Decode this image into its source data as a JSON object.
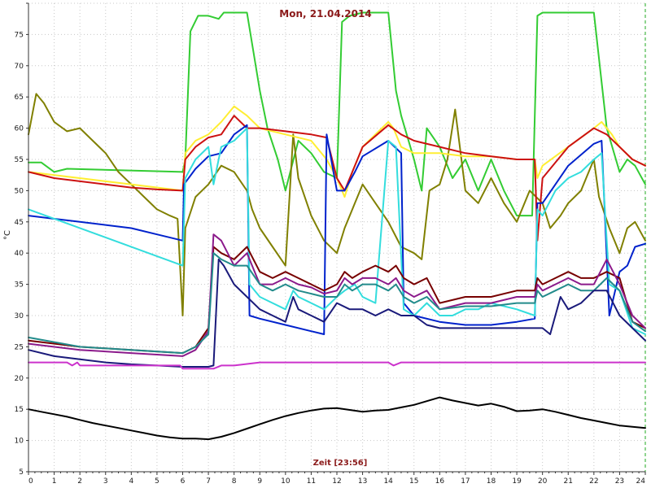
{
  "chart_data": {
    "type": "line",
    "title": "Mon, 21.04.2014",
    "xlabel": "Zeit [23:56]",
    "ylabel": "°C",
    "xlim": [
      0,
      24
    ],
    "ylim": [
      5,
      80
    ],
    "xticks": [
      0,
      1,
      2,
      3,
      4,
      5,
      6,
      7,
      8,
      9,
      10,
      11,
      12,
      13,
      14,
      15,
      16,
      17,
      18,
      19,
      20,
      21,
      22,
      23,
      24
    ],
    "yticks": [
      5,
      10,
      15,
      20,
      25,
      30,
      35,
      40,
      45,
      50,
      55,
      60,
      65,
      70,
      75,
      80
    ],
    "grid": true,
    "series": [
      {
        "color": "#33cc33",
        "x": [
          0,
          0.5,
          1,
          1.5,
          6,
          6.1,
          6.3,
          6.6,
          7,
          7.4,
          7.6,
          8,
          8.5,
          9,
          9.3,
          9.7,
          10,
          10.5,
          11,
          11.5,
          12,
          12.2,
          12.5,
          13,
          14,
          14.3,
          14.5,
          15,
          15.3,
          15.5,
          16,
          16.5,
          17,
          17.5,
          18,
          18.5,
          19,
          19.6,
          19.8,
          20,
          20.4,
          21,
          21.5,
          22,
          22.5,
          23,
          23.3,
          23.6,
          24
        ],
        "y": [
          54.5,
          54.5,
          53,
          53.5,
          53,
          55,
          75.5,
          78,
          78,
          77.5,
          78.5,
          78.5,
          78.5,
          66,
          60,
          55,
          50,
          58,
          56,
          53,
          52,
          77,
          78,
          78.5,
          78.5,
          66,
          62,
          55,
          50,
          60,
          57,
          52,
          55,
          50,
          55,
          50,
          46,
          46,
          78,
          78.5,
          78.5,
          78.5,
          78.5,
          78.5,
          60,
          53,
          55,
          54,
          51
        ]
      },
      {
        "color": "#808000",
        "x": [
          0,
          0.3,
          0.6,
          1,
          1.5,
          2,
          2.5,
          3,
          3.5,
          4,
          4.5,
          5,
          5.5,
          5.8,
          6,
          6.1,
          6.5,
          7,
          7.5,
          8,
          8.5,
          8.7,
          9,
          9.5,
          10,
          10.3,
          10.5,
          11,
          11.5,
          12,
          12.3,
          12.7,
          13,
          13.5,
          14,
          14.5,
          15,
          15.3,
          15.6,
          16,
          16.3,
          16.6,
          17,
          17.5,
          18,
          18.5,
          19,
          19.5,
          20,
          20.3,
          20.7,
          21,
          21.5,
          22,
          22.2,
          22.6,
          23,
          23.3,
          23.6,
          24
        ],
        "y": [
          59,
          65.5,
          64,
          61,
          59.5,
          60,
          58,
          56,
          53,
          51,
          49,
          47,
          46,
          45.5,
          30,
          44,
          49,
          51,
          54,
          53,
          50,
          47,
          44,
          41,
          38,
          59,
          52,
          46,
          42,
          40,
          44,
          48,
          51,
          48,
          45,
          41,
          40,
          39,
          50,
          51,
          55,
          63,
          50,
          48,
          52,
          48,
          45,
          50,
          48,
          44,
          46,
          48,
          50,
          55,
          49,
          44,
          40,
          44,
          45,
          42
        ]
      },
      {
        "color": "#ffee33",
        "x": [
          0,
          6,
          6.1,
          6.5,
          7,
          7.5,
          8,
          8.5,
          9,
          10,
          11,
          11.6,
          12,
          12.3,
          12.6,
          13,
          14,
          14.2,
          14.5,
          15,
          16,
          17,
          18,
          19,
          19.7,
          19.8,
          20,
          21,
          22,
          22.3,
          22.7,
          23,
          23.5,
          24
        ],
        "y": [
          53,
          50,
          56,
          58,
          59,
          61,
          63.5,
          62,
          60,
          59,
          58,
          55,
          52,
          49,
          53,
          57,
          61,
          60,
          57,
          56,
          56,
          55.5,
          55.5,
          55,
          55,
          52,
          54,
          57,
          60,
          61,
          59,
          57,
          55,
          54
        ]
      },
      {
        "color": "#cc1111",
        "x": [
          0,
          1,
          2,
          3,
          4,
          5,
          6,
          6.1,
          6.5,
          7,
          7.5,
          8,
          8.5,
          9,
          10,
          11,
          11.6,
          12,
          12.3,
          12.7,
          13,
          14,
          14.5,
          15,
          16,
          17,
          18,
          19,
          19.7,
          19.8,
          20,
          21,
          22,
          22.5,
          23,
          23.5,
          24
        ],
        "y": [
          53,
          52,
          51.5,
          51,
          50.5,
          50.2,
          50,
          55,
          57,
          58.5,
          59,
          62,
          60,
          60,
          59.5,
          59,
          58.5,
          52,
          50,
          54,
          57,
          60.5,
          59,
          58,
          57,
          56,
          55.5,
          55,
          55,
          42,
          52,
          57,
          60,
          59,
          57,
          55,
          54
        ]
      },
      {
        "color": "#0022cc",
        "x": [
          0,
          1,
          2,
          3,
          4,
          5,
          6,
          6.05,
          6.5,
          7,
          7.5,
          8,
          8.5,
          8.6,
          9,
          10,
          11,
          11.5,
          11.6,
          12,
          12.3,
          12.7,
          13,
          14,
          14.5,
          14.6,
          15,
          16,
          17,
          18,
          19,
          19.7,
          19.8,
          20,
          21,
          22,
          22.3,
          22.6,
          23,
          23.3,
          23.6,
          24
        ],
        "y": [
          46,
          45.5,
          45,
          44.5,
          44,
          43,
          42,
          51,
          53.5,
          55.5,
          56,
          59,
          60.5,
          30,
          29.5,
          28.5,
          27.5,
          27,
          59,
          50,
          50,
          53,
          55.5,
          58,
          56,
          32,
          30,
          29,
          28.5,
          28.5,
          29,
          29.5,
          48,
          48,
          54,
          57.5,
          58,
          30,
          37,
          38,
          41,
          41.5
        ]
      },
      {
        "color": "#33dddd",
        "x": [
          0,
          6,
          6.1,
          6.5,
          7,
          7.2,
          7.5,
          8,
          8.5,
          8.6,
          9,
          9.5,
          10,
          10.3,
          10.5,
          11,
          11.5,
          12,
          12.3,
          12.7,
          13,
          13.5,
          14,
          14.3,
          14.6,
          15,
          15.5,
          16,
          16.5,
          17,
          17.5,
          18,
          19,
          19.7,
          19.8,
          20,
          20.5,
          21,
          21.5,
          22,
          22.3,
          22.6,
          23,
          23.5,
          24
        ],
        "y": [
          47,
          38,
          52,
          55,
          57,
          51,
          57,
          58,
          60,
          35,
          33,
          32,
          31,
          34,
          33,
          32,
          31,
          33,
          34,
          35,
          33,
          32,
          58,
          57,
          31,
          30,
          32,
          30,
          30,
          31,
          31,
          32,
          31,
          30,
          47,
          46,
          50,
          52,
          53,
          55,
          56,
          35,
          34,
          28,
          27
        ]
      },
      {
        "color": "#770000",
        "x": [
          0,
          2,
          4,
          6,
          6.5,
          7,
          7.2,
          7.5,
          8,
          8.5,
          9,
          9.5,
          10,
          10.5,
          11,
          11.5,
          12,
          12.3,
          12.6,
          13,
          13.5,
          14,
          14.3,
          14.6,
          15,
          15.5,
          16,
          17,
          18,
          19,
          19.7,
          19.8,
          20,
          20.5,
          21,
          21.5,
          22,
          22.5,
          23,
          23.5,
          24
        ],
        "y": [
          26,
          25,
          24.5,
          24,
          25,
          28,
          41,
          40,
          39,
          41,
          37,
          36,
          37,
          36,
          35,
          34,
          35,
          37,
          36,
          37,
          38,
          37,
          38,
          36,
          35,
          36,
          32,
          33,
          33,
          34,
          34,
          36,
          35,
          36,
          37,
          36,
          36,
          37,
          36,
          29,
          28
        ]
      },
      {
        "color": "#8b1a8b",
        "x": [
          0,
          2,
          4,
          6,
          6.5,
          7,
          7.2,
          7.5,
          8,
          8.5,
          9,
          9.5,
          10,
          10.5,
          11,
          11.5,
          12,
          12.3,
          12.6,
          13,
          13.5,
          14,
          14.3,
          14.6,
          15,
          15.5,
          16,
          17,
          18,
          19,
          19.7,
          19.8,
          20,
          20.5,
          21,
          21.5,
          22,
          22.5,
          23,
          23.5,
          24
        ],
        "y": [
          25.5,
          24.5,
          24,
          23.5,
          24.5,
          27.5,
          43,
          42,
          38,
          40,
          35,
          35,
          36,
          35,
          34.5,
          33.5,
          34,
          36,
          35,
          36,
          36,
          35,
          36,
          34,
          33,
          34,
          31,
          32,
          32,
          33,
          33,
          35,
          34,
          35,
          36,
          35,
          35,
          39,
          35,
          30,
          28
        ]
      },
      {
        "color": "#228b8b",
        "x": [
          0,
          2,
          4,
          6,
          6.5,
          7,
          7.2,
          7.5,
          8,
          8.5,
          9,
          9.5,
          10,
          10.5,
          11,
          11.5,
          12,
          12.3,
          12.6,
          13,
          13.5,
          14,
          14.3,
          14.6,
          15,
          15.5,
          16,
          17,
          18,
          19,
          19.7,
          19.8,
          20,
          20.5,
          21,
          21.5,
          22,
          22.5,
          23,
          23.5,
          24
        ],
        "y": [
          26.5,
          25,
          24.5,
          24,
          25,
          27,
          40,
          39,
          38,
          38,
          35,
          34,
          35,
          34,
          33.5,
          33,
          33,
          35,
          34,
          35,
          35,
          34,
          35,
          33,
          32,
          33,
          31,
          31.5,
          31.5,
          32,
          32,
          34,
          33,
          34,
          35,
          34,
          34,
          36,
          34,
          29,
          27.5
        ]
      },
      {
        "color": "#1a1a7a",
        "x": [
          0,
          1,
          2,
          3,
          4,
          5,
          6,
          6.5,
          7,
          7.2,
          7.4,
          7.6,
          8,
          8.5,
          9,
          9.5,
          10,
          10.3,
          10.5,
          11,
          11.5,
          12,
          12.5,
          13,
          13.5,
          14,
          14.5,
          15,
          15.5,
          16,
          17,
          18,
          19,
          19.7,
          19.8,
          20,
          20.3,
          20.7,
          21,
          21.5,
          22,
          22.5,
          23,
          23.5,
          24
        ],
        "y": [
          24.5,
          23.5,
          23,
          22.5,
          22.2,
          22,
          21.8,
          21.8,
          21.8,
          22,
          39,
          38,
          35,
          33,
          31,
          30,
          29,
          33,
          31,
          30,
          29,
          32,
          31,
          31,
          30,
          31,
          30,
          30,
          28.5,
          28,
          28,
          28,
          28,
          28,
          28,
          28,
          27,
          33,
          31,
          32,
          34,
          34,
          30,
          28,
          26
        ]
      },
      {
        "color": "#cc33cc",
        "x": [
          0,
          1,
          1.5,
          1.7,
          1.9,
          2,
          2.5,
          3,
          4,
          5,
          5.9,
          6,
          6.5,
          7,
          7.2,
          7.5,
          8,
          9,
          10,
          11,
          12,
          13,
          14,
          14.2,
          14.5,
          15,
          16,
          17,
          18,
          19,
          20,
          21,
          22,
          23,
          24
        ],
        "y": [
          22.5,
          22.5,
          22.5,
          22,
          22.5,
          22,
          22,
          22,
          22,
          22,
          22,
          21.5,
          21.5,
          21.5,
          21.5,
          22,
          22,
          22.5,
          22.5,
          22.5,
          22.5,
          22.5,
          22.5,
          22,
          22.5,
          22.5,
          22.5,
          22.5,
          22.5,
          22.5,
          22.5,
          22.5,
          22.5,
          22.5,
          22.5
        ]
      },
      {
        "color": "#000000",
        "x": [
          0,
          0.5,
          1,
          1.5,
          2,
          2.5,
          3,
          3.5,
          4,
          4.5,
          5,
          5.5,
          6,
          6.5,
          7,
          7.5,
          8,
          8.5,
          9,
          9.5,
          10,
          10.5,
          11,
          11.5,
          12,
          12.5,
          13,
          13.5,
          14,
          14.5,
          15,
          15.5,
          16,
          16.5,
          17,
          17.5,
          18,
          18.5,
          19,
          19.5,
          20,
          20.5,
          21,
          21.5,
          22,
          22.5,
          23,
          23.5,
          24
        ],
        "y": [
          15,
          14.6,
          14.2,
          13.8,
          13.3,
          12.8,
          12.4,
          12,
          11.6,
          11.2,
          10.8,
          10.5,
          10.3,
          10.3,
          10.2,
          10.6,
          11.2,
          11.9,
          12.6,
          13.3,
          13.9,
          14.4,
          14.8,
          15.1,
          15.2,
          14.9,
          14.6,
          14.8,
          14.9,
          15.3,
          15.7,
          16.3,
          16.9,
          16.4,
          16,
          15.6,
          15.9,
          15.4,
          14.7,
          14.8,
          15,
          14.6,
          14.1,
          13.6,
          13.2,
          12.8,
          12.4,
          12.2,
          12
        ]
      }
    ]
  }
}
